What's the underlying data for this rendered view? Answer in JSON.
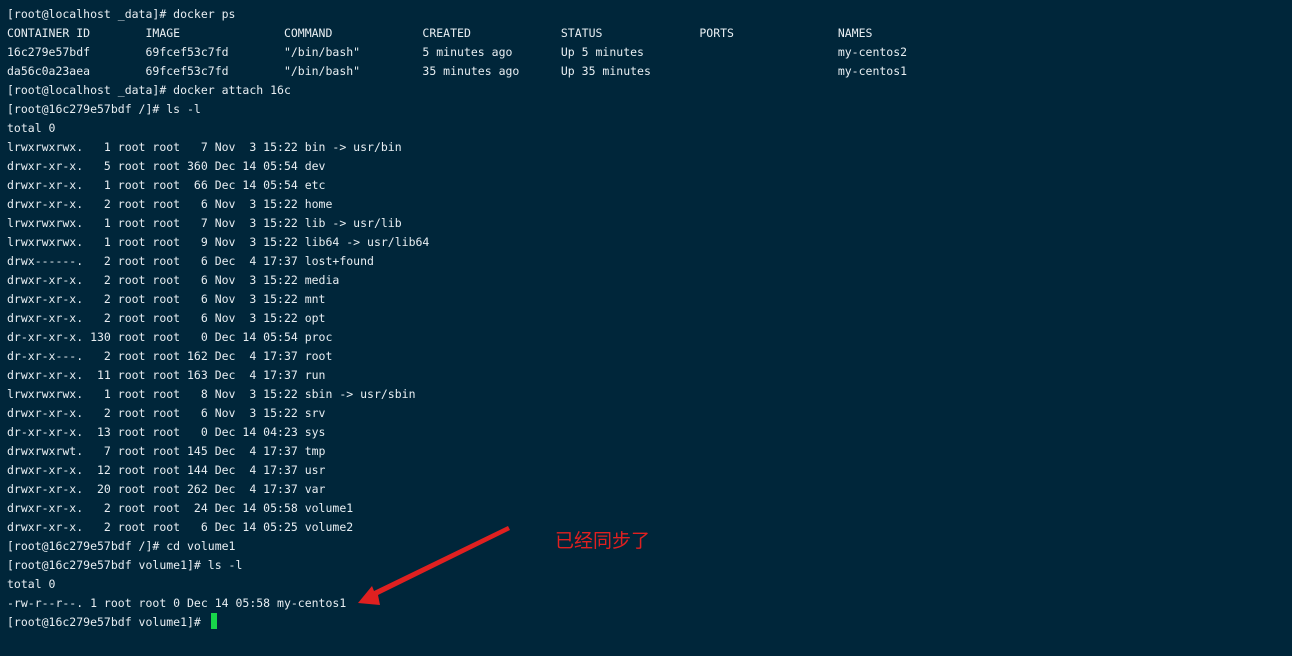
{
  "terminal": {
    "lines": [
      "[root@localhost _data]# docker ps",
      "CONTAINER ID        IMAGE               COMMAND             CREATED             STATUS              PORTS               NAMES",
      "16c279e57bdf        69fcef53c7fd        \"/bin/bash\"         5 minutes ago       Up 5 minutes                            my-centos2",
      "da56c0a23aea        69fcef53c7fd        \"/bin/bash\"         35 minutes ago      Up 35 minutes                           my-centos1",
      "[root@localhost _data]# docker attach 16c",
      "[root@16c279e57bdf /]# ls -l",
      "total 0",
      "lrwxrwxrwx.   1 root root   7 Nov  3 15:22 bin -> usr/bin",
      "drwxr-xr-x.   5 root root 360 Dec 14 05:54 dev",
      "drwxr-xr-x.   1 root root  66 Dec 14 05:54 etc",
      "drwxr-xr-x.   2 root root   6 Nov  3 15:22 home",
      "lrwxrwxrwx.   1 root root   7 Nov  3 15:22 lib -> usr/lib",
      "lrwxrwxrwx.   1 root root   9 Nov  3 15:22 lib64 -> usr/lib64",
      "drwx------.   2 root root   6 Dec  4 17:37 lost+found",
      "drwxr-xr-x.   2 root root   6 Nov  3 15:22 media",
      "drwxr-xr-x.   2 root root   6 Nov  3 15:22 mnt",
      "drwxr-xr-x.   2 root root   6 Nov  3 15:22 opt",
      "dr-xr-xr-x. 130 root root   0 Dec 14 05:54 proc",
      "dr-xr-x---.   2 root root 162 Dec  4 17:37 root",
      "drwxr-xr-x.  11 root root 163 Dec  4 17:37 run",
      "lrwxrwxrwx.   1 root root   8 Nov  3 15:22 sbin -> usr/sbin",
      "drwxr-xr-x.   2 root root   6 Nov  3 15:22 srv",
      "dr-xr-xr-x.  13 root root   0 Dec 14 04:23 sys",
      "drwxrwxrwt.   7 root root 145 Dec  4 17:37 tmp",
      "drwxr-xr-x.  12 root root 144 Dec  4 17:37 usr",
      "drwxr-xr-x.  20 root root 262 Dec  4 17:37 var",
      "drwxr-xr-x.   2 root root  24 Dec 14 05:58 volume1",
      "drwxr-xr-x.   2 root root   6 Dec 14 05:25 volume2",
      "[root@16c279e57bdf /]# cd volume1",
      "[root@16c279e57bdf volume1]# ls -l",
      "total 0",
      "-rw-r--r--. 1 root root 0 Dec 14 05:58 my-centos1",
      "[root@16c279e57bdf volume1]# "
    ]
  },
  "annotation": {
    "text": "已经同步了",
    "color": "#e02020"
  },
  "colors": {
    "background": "#00263a",
    "foreground": "#e8eef2",
    "cursor": "#18d64a"
  }
}
